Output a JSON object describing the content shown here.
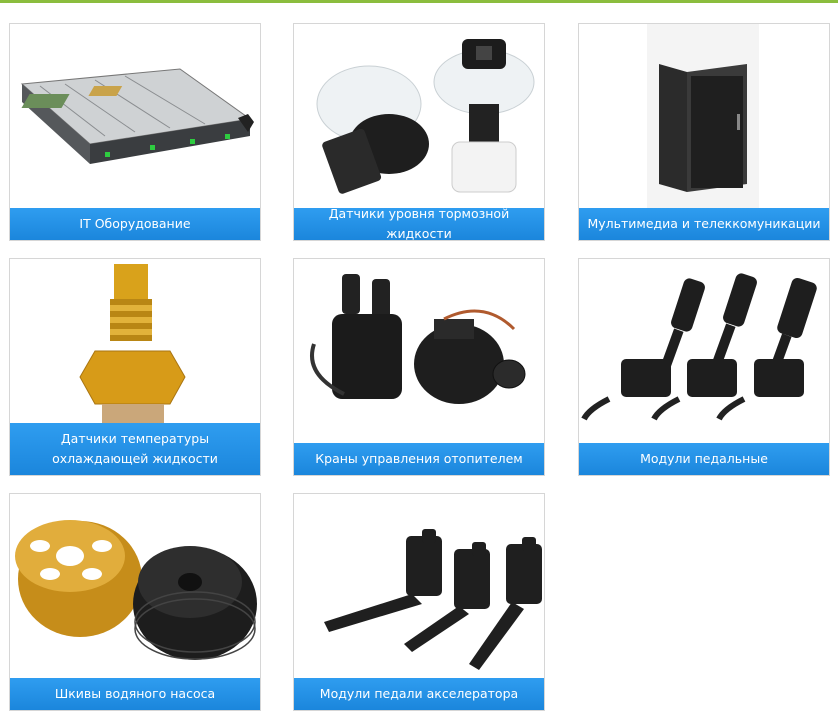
{
  "accent_color": "#8bbd3e",
  "caption_color": "#2196f3",
  "categories": [
    {
      "label": "IT Оборудование",
      "icon": "server-rack-image"
    },
    {
      "label": "Датчики уровня тормозной жидкости",
      "icon": "brake-fluid-sensor-image"
    },
    {
      "label": "Мультимедиа и телеккомуникации",
      "icon": "telecom-cabinet-image"
    },
    {
      "label": "Датчики температуры охлаждающей жидкости",
      "icon": "coolant-temperature-sensor-image"
    },
    {
      "label": "Краны управления отопителем",
      "icon": "heater-valve-image"
    },
    {
      "label": "Модули педальные",
      "icon": "pedal-module-image"
    },
    {
      "label": "Шкивы водяного насоса",
      "icon": "water-pump-pulley-image"
    },
    {
      "label": "Модули педали акселератора",
      "icon": "accelerator-pedal-module-image"
    }
  ]
}
